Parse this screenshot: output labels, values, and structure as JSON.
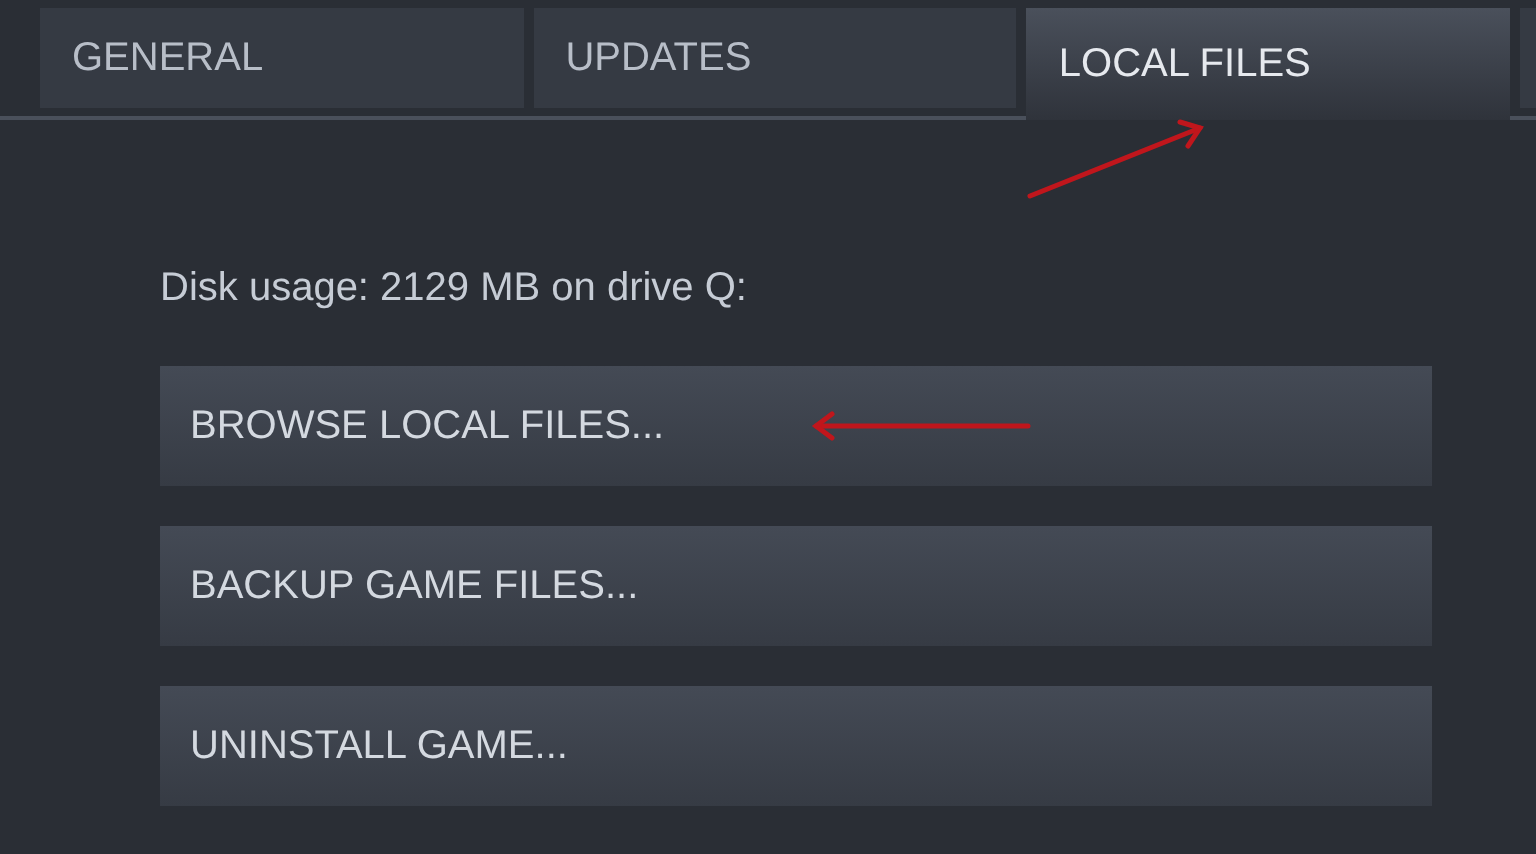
{
  "tabs": [
    {
      "label": "GENERAL",
      "selected": false
    },
    {
      "label": "UPDATES",
      "selected": false
    },
    {
      "label": "LOCAL FILES",
      "selected": true
    }
  ],
  "disk_usage": "Disk usage: 2129 MB on drive Q:",
  "buttons": [
    "BROWSE LOCAL FILES...",
    "BACKUP GAME FILES...",
    "UNINSTALL GAME..."
  ]
}
